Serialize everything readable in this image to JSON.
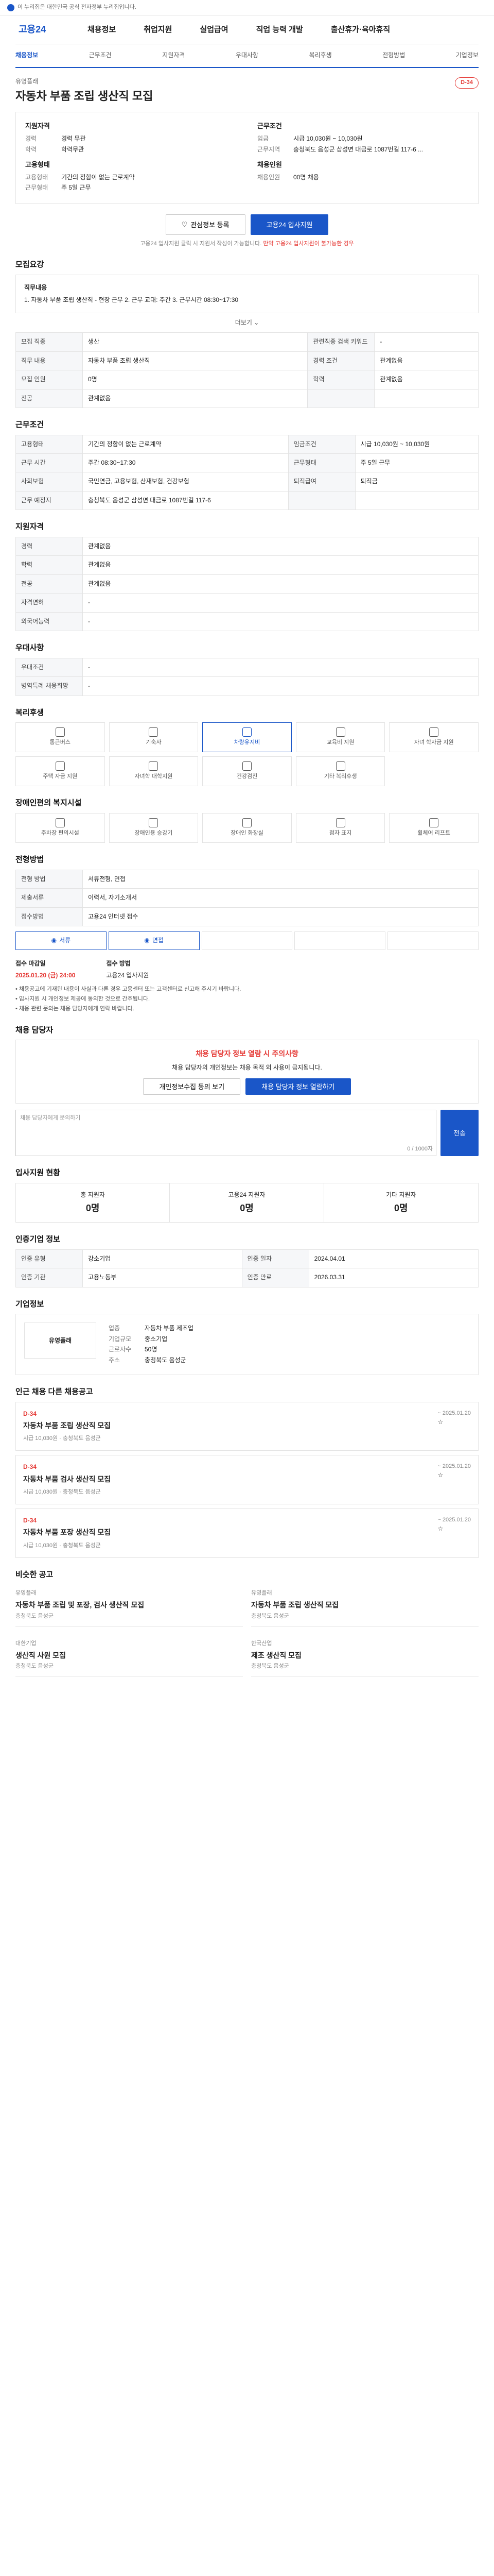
{
  "topbar": {
    "text": "이 누리집은 대한민국 공식 전자정부 누리집입니다."
  },
  "gnb": {
    "logo": "고용24",
    "menus": [
      "채용정보",
      "취업지원",
      "실업급여",
      "직업 능력 개발",
      "출산휴가·육아휴직"
    ]
  },
  "subnav": {
    "items": [
      "채용정보",
      "근무조건",
      "지원자격",
      "우대사항",
      "복리후생",
      "전형방법",
      "기업정보"
    ]
  },
  "header": {
    "company": "유영플래",
    "title": "자동차 부품 조립 생산직 모집",
    "dday": "D-34"
  },
  "summary": {
    "left_title": "지원자격",
    "left": [
      [
        "경력",
        "경력 무관"
      ],
      [
        "학력",
        "학력무관"
      ]
    ],
    "left2_title": "고용형태",
    "left2": [
      [
        "고용형태",
        "기간의 정함이 없는 근로계약"
      ],
      [
        "근무형태",
        "주 5일 근무"
      ]
    ],
    "right_title": "근무조건",
    "right": [
      [
        "임금",
        "시급 10,030원 ~ 10,030원"
      ],
      [
        "근무지역",
        "충청북도 음성군 삼성면 대금로 1087번길 117-6 ..."
      ]
    ],
    "right2_title": "채용인원",
    "right2": [
      [
        "채용인원",
        "00명 채용"
      ]
    ]
  },
  "actions": {
    "favorite": "관심정보 등록",
    "apply": "고용24 입사지원"
  },
  "notice": {
    "text": "고용24 입사지원 클릭 시 지원서 작성이 가능합니다.",
    "warn": "만약 고용24 입사지원이 불가능한 경우"
  },
  "sections": {
    "recruit": "모집요강",
    "duty_title": "직무내용",
    "duty": "1. 자동차 부품 조립 생산직 - 현장 근무 2. 근무 교대: 주간 3. 근무시간 08:30~17:30",
    "more": "더보기",
    "cond": "근무조건",
    "qual": "지원자격",
    "pref": "우대사항",
    "welfare": "복리후생",
    "disabled": "장애인편의 복지시설",
    "process": "전형방법",
    "contact": "채용 담당자",
    "stats": "입사지원 현황",
    "info": "인증기업 정보",
    "company": "기업정보",
    "other": "인근 채용 다른 채용공고",
    "recommend": "비슷한 공고"
  },
  "recruit_table": [
    [
      "모집 직종",
      "생산",
      "관련직종 검색 키워드",
      "-"
    ],
    [
      "직무 내용",
      "자동차 부품 조립 생산직",
      "경력 조건",
      "관계없음"
    ],
    [
      "모집 인원",
      "0명",
      "학력",
      "관계없음"
    ],
    [
      "전공",
      "관계없음",
      "",
      ""
    ]
  ],
  "cond_table": [
    [
      "고용형태",
      "기간의 정함이 없는 근로계약",
      "임금조건",
      "시급 10,030원 ~ 10,030원"
    ],
    [
      "근무 시간",
      "주간 08:30~17:30",
      "근무형태",
      "주 5일 근무"
    ],
    [
      "사회보험",
      "국민연금, 고용보험, 산재보험, 건강보험",
      "퇴직급여",
      "퇴직금"
    ],
    [
      "근무 예정지",
      "충청북도 음성군 삼성면 대금로 1087번길 117-6",
      "",
      ""
    ]
  ],
  "qual_table": [
    [
      "경력",
      "관계없음"
    ],
    [
      "학력",
      "관계없음"
    ],
    [
      "전공",
      "관계없음"
    ],
    [
      "자격면허",
      "-"
    ],
    [
      "외국어능력",
      "-"
    ]
  ],
  "pref_table": [
    [
      "우대조건",
      "-"
    ],
    [
      "병역특례 채용희망",
      "-"
    ]
  ],
  "welfare": [
    [
      "통근버스",
      false
    ],
    [
      "기숙사",
      false
    ],
    [
      "차량유지비",
      true
    ],
    [
      "교육비 지원",
      false
    ],
    [
      "자녀 학자금 지원",
      false
    ],
    [
      "주택 자금 지원",
      false
    ],
    [
      "자녀학 대학지원",
      false
    ],
    [
      "건강검진",
      false
    ],
    [
      "기타 복리후생",
      false
    ]
  ],
  "disabled": [
    [
      "주차장 편의시설"
    ],
    [
      "장애인용 승강기"
    ],
    [
      "장애인 화장실"
    ],
    [
      "점자 표지"
    ],
    [
      "휠체어 리프트"
    ]
  ],
  "process_table": [
    [
      "전형 방법",
      "서류전형, 면접"
    ],
    [
      "제출서류",
      "이력서, 자기소개서"
    ],
    [
      "접수방법",
      "고용24 인터넷 접수"
    ]
  ],
  "process_steps": [
    "서류",
    "면접",
    "",
    "",
    ""
  ],
  "apply": {
    "period_label": "접수 마감일",
    "period": "2025.01.20 (금) 24:00",
    "method_label": "접수 방법",
    "method": "고용24 입사지원"
  },
  "bullets": [
    "채용공고에 기재된 내용이 사실과 다른 경우 고용센터 또는 고객센터로 신고해 주시기 바랍니다.",
    "입사지원 시 개인정보 제공에 동의한 것으로 간주됩니다.",
    "채용 관련 문의는 채용 담당자에게 연락 바랍니다."
  ],
  "contact": {
    "warn_title": "채용 담당자 정보 열람 시 주의사항",
    "warn_text": "채용 담당자의 개인정보는 채용 목적 외 사용이 금지됩니다.",
    "btn1": "개인정보수집 동의 보기",
    "btn2": "채용 담당자 정보 열람하기",
    "textarea": "채용 담당자에게 문의하기",
    "counter": "0 / 1000자",
    "send": "전송"
  },
  "stats": {
    "items": [
      [
        "총 지원자",
        "0명"
      ],
      [
        "고용24 지원자",
        "0명"
      ],
      [
        "기타 지원자",
        "0명"
      ]
    ]
  },
  "info_table": [
    [
      "인증 유형",
      "강소기업",
      "인증 일자",
      "2024.04.01"
    ],
    [
      "인증 기관",
      "고용노동부",
      "인증 만료",
      "2026.03.31"
    ]
  ],
  "company": {
    "name": "유영플래",
    "industry": "자동차 부품 제조업",
    "size": "중소기업",
    "employees": "50명",
    "addr": "충청북도 음성군"
  },
  "other_jobs": [
    {
      "dday": "D-34",
      "title": "자동차 부품 조립 생산직 모집",
      "wage": "시급 10,030원",
      "loc": "충청북도 음성군",
      "date": "~ 2025.01.20"
    },
    {
      "dday": "D-34",
      "title": "자동차 부품 검사 생산직 모집",
      "wage": "시급 10,030원",
      "loc": "충청북도 음성군",
      "date": "~ 2025.01.20"
    },
    {
      "dday": "D-34",
      "title": "자동차 부품 포장 생산직 모집",
      "wage": "시급 10,030원",
      "loc": "충청북도 음성군",
      "date": "~ 2025.01.20"
    }
  ],
  "recommend": [
    {
      "company": "유영플래",
      "title": "자동차 부품 조립 및 포장, 검사 생산직 모집",
      "loc": "충청북도 음성군"
    },
    {
      "company": "유영플래",
      "title": "자동차 부품 조립 생산직 모집",
      "loc": "충청북도 음성군"
    },
    {
      "company": "대한기업",
      "title": "생산직 사원 모집",
      "loc": "충청북도 음성군"
    },
    {
      "company": "한국산업",
      "title": "제조 생산직 모집",
      "loc": "충청북도 음성군"
    }
  ]
}
